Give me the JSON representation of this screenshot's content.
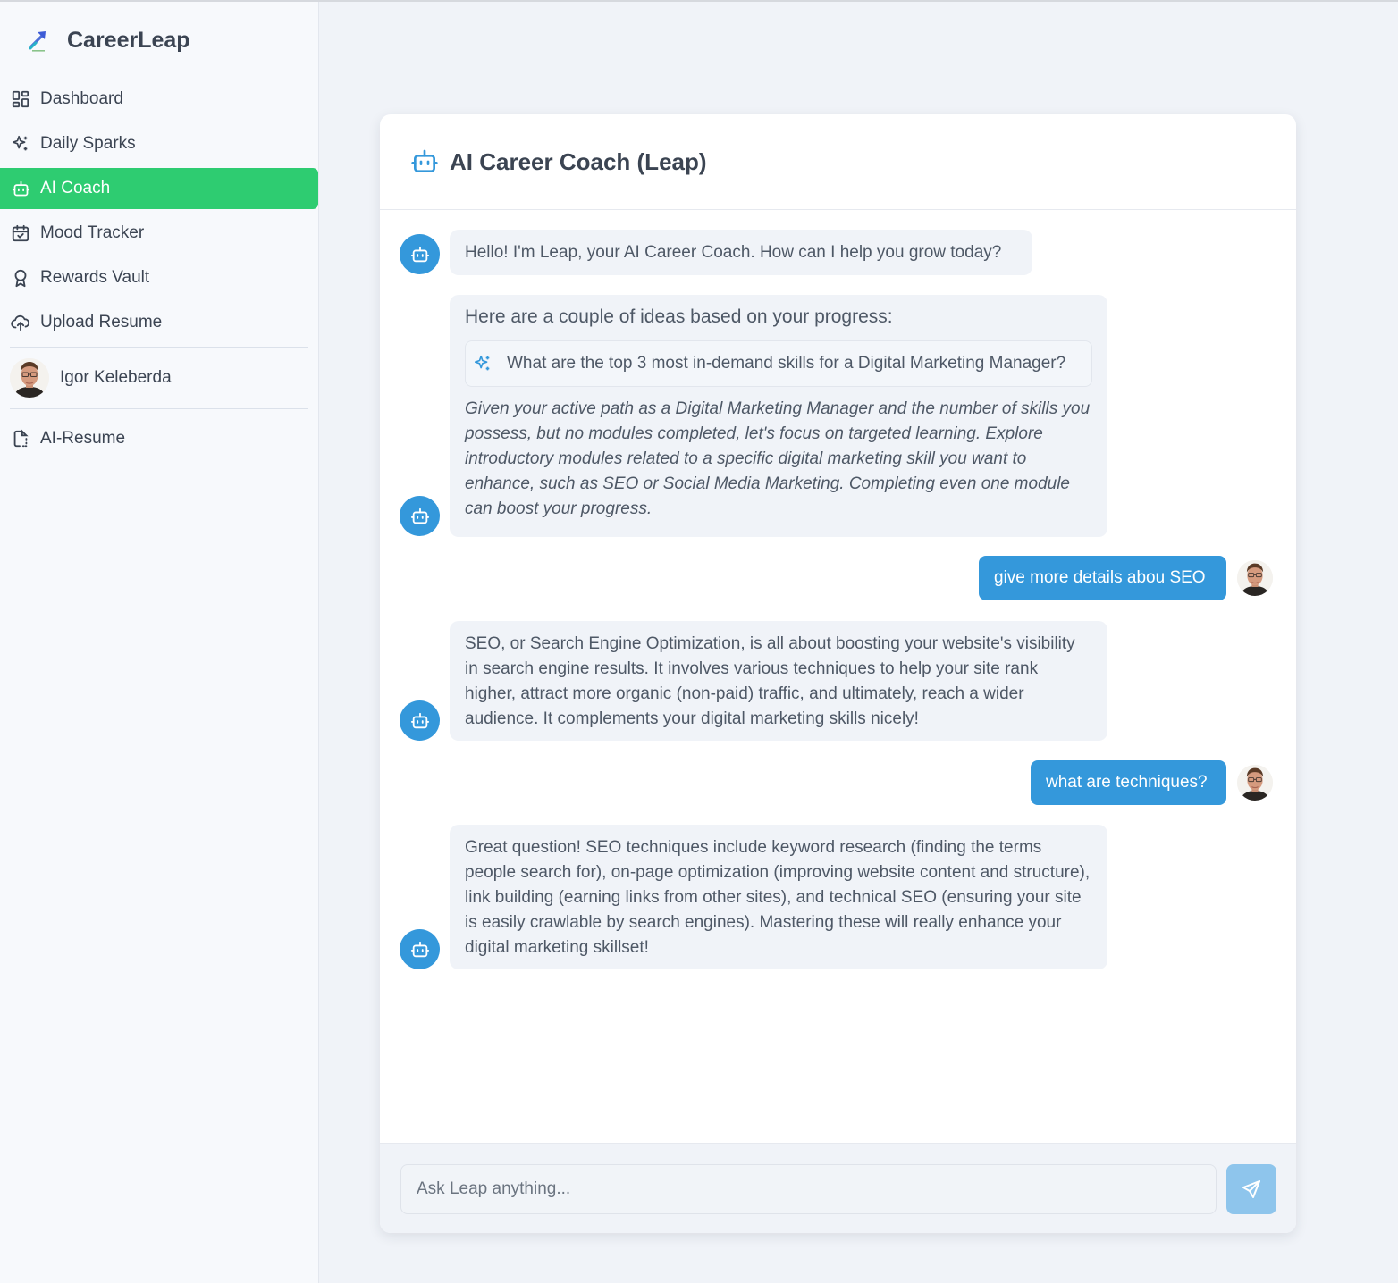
{
  "app": {
    "name": "CareerLeap"
  },
  "sidebar": {
    "items": [
      {
        "label": "Dashboard",
        "icon": "dashboard-icon"
      },
      {
        "label": "Daily Sparks",
        "icon": "sparkles-icon"
      },
      {
        "label": "AI Coach",
        "icon": "bot-icon",
        "active": true
      },
      {
        "label": "Mood Tracker",
        "icon": "calendar-check-icon"
      },
      {
        "label": "Rewards Vault",
        "icon": "award-icon"
      },
      {
        "label": "Upload Resume",
        "icon": "cloud-upload-icon"
      }
    ],
    "user": {
      "name": "Igor Keleberda"
    },
    "extra": [
      {
        "label": "AI-Resume",
        "icon": "file-dashed-icon"
      }
    ]
  },
  "chat": {
    "title": "AI Career Coach (Leap)",
    "messages": [
      {
        "role": "bot",
        "text": "Hello! I'm Leap, your AI Career Coach. How can I help you grow today?"
      },
      {
        "role": "bot",
        "intro": "Here are a couple of ideas based on your progress:",
        "suggestion": "What are the top 3 most in-demand skills for a Digital Marketing Manager?",
        "text": "Given your active path as a Digital Marketing Manager and the number of skills you possess, but no modules completed, let's focus on targeted learning. Explore introductory modules related to a specific digital marketing skill you want to enhance, such as SEO or Social Media Marketing. Completing even one module can boost your progress."
      },
      {
        "role": "user",
        "text": "give more details abou SEO"
      },
      {
        "role": "bot",
        "text": "SEO, or Search Engine Optimization, is all about boosting your website's visibility in search engine results. It involves various techniques to help your site rank higher, attract more organic (non-paid) traffic, and ultimately, reach a wider audience. It complements your digital marketing skills nicely!"
      },
      {
        "role": "user",
        "text": "what are techniques?"
      },
      {
        "role": "bot",
        "text": "Great question! SEO techniques include keyword research (finding the terms people search for), on-page optimization (improving website content and structure), link building (earning links from other sites), and technical SEO (ensuring your site is easily crawlable by search engines). Mastering these will really enhance your digital marketing skillset!"
      }
    ],
    "input": {
      "placeholder": "Ask Leap anything...",
      "value": ""
    }
  },
  "colors": {
    "accent_active": "#2ecc71",
    "primary_blue": "#3498db",
    "send_button": "#8ec5ec",
    "bubble_bg": "#f0f3f8"
  }
}
